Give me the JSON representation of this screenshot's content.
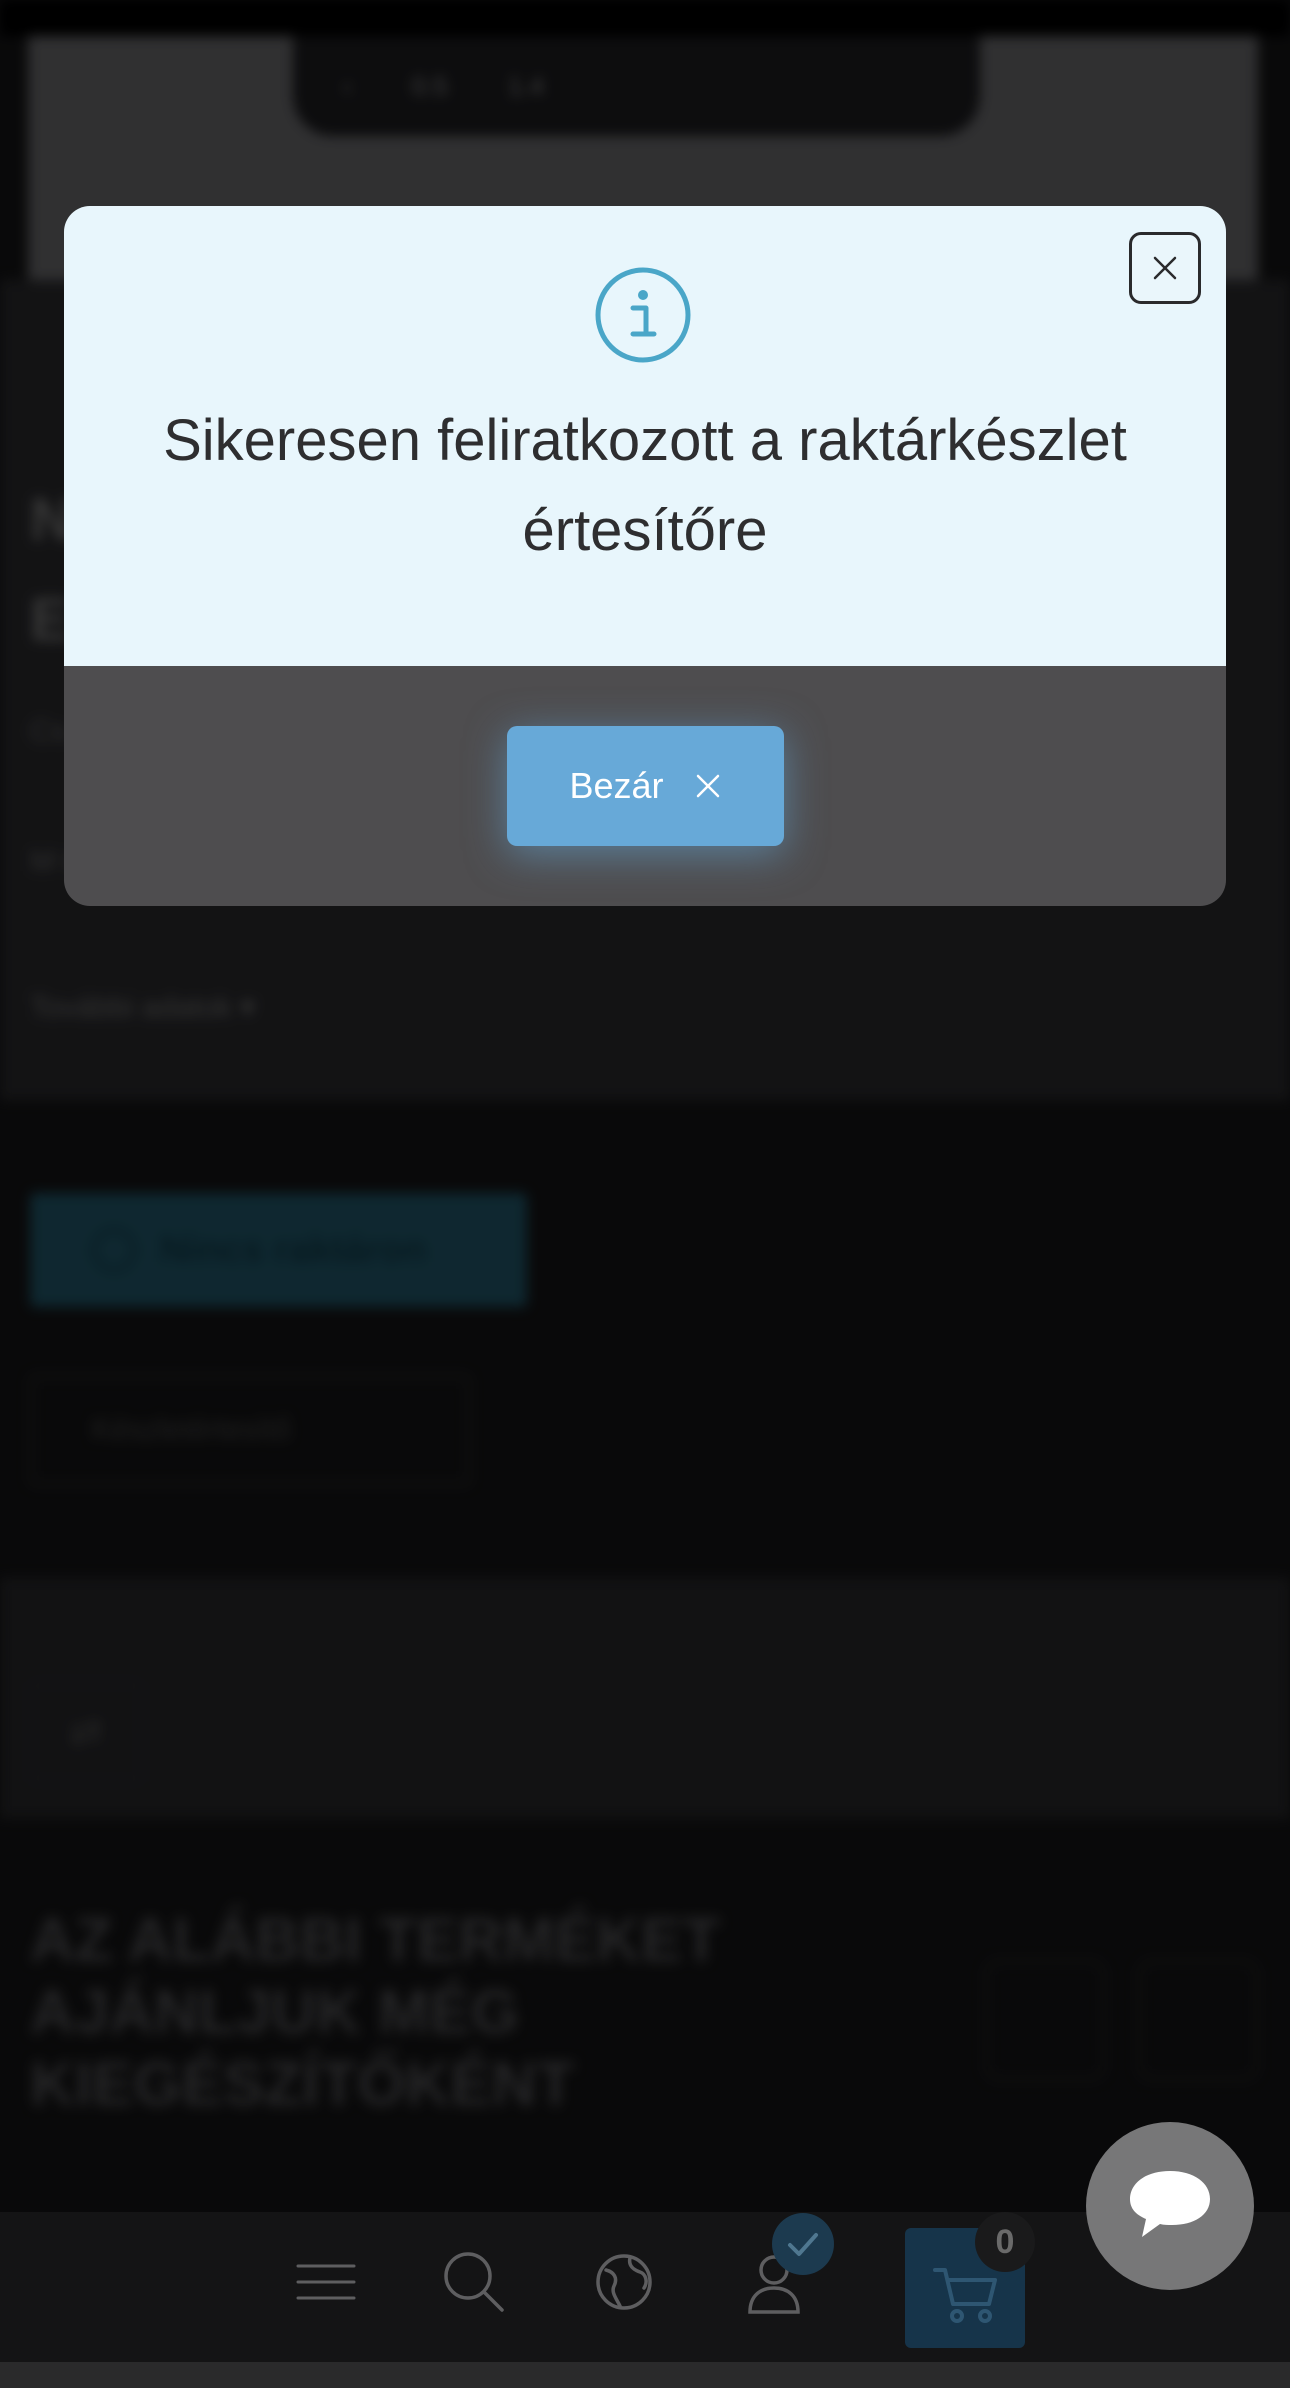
{
  "background": {
    "video_controls": [
      "‹",
      "0.5",
      "1.4"
    ],
    "title_fragment": "N E",
    "desc_line1": "Cs m",
    "desc_line2": "M ting",
    "more_link": "További adatok ▾",
    "stock_label": "Nincs raktáron",
    "notify_label": "Készletértesítő",
    "recommend_title": "AZ ALÁBBI TERMÉKET AJÁNLJUK MÉG KIEGÉSZÍTŐKÉNT"
  },
  "modal": {
    "message": "Sikeresen feliratkozott a raktárkészlet értesítőre",
    "close_button_label": "Bezár"
  },
  "bottom_nav": {
    "cart_count": "0",
    "icons": [
      "menu-icon",
      "search-icon",
      "globe-icon",
      "user-icon",
      "cart-icon"
    ]
  },
  "colors": {
    "modal_top": "#e8f6fc",
    "modal_bottom": "#4e4d4f",
    "accent": "#67a9d8",
    "info_icon": "#4aa6c8"
  }
}
